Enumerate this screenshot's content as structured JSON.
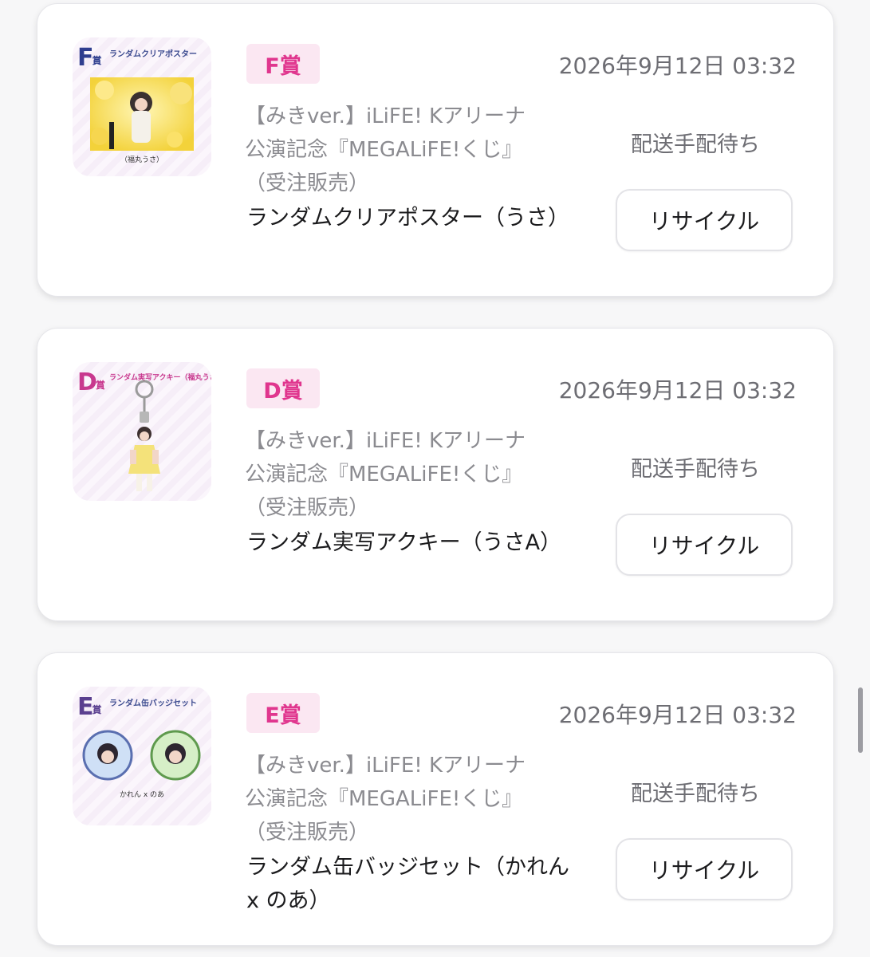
{
  "items": [
    {
      "badge": "F賞",
      "date": "2026年9月12日 03:32",
      "lottery_lines": [
        "【みきver.】iLiFE! Kアリーナ",
        "公演記念『MEGALiFE!くじ』",
        "（受注販売）"
      ],
      "prize_name": "ランダムクリアポスター（うさ）",
      "status": "配送手配待ち",
      "action_label": "リサイクル",
      "thumb_letter": "F",
      "thumb_caption": "ランダムクリアポスター",
      "thumb_footer": "（福丸うさ）",
      "thumb_icon": "poster-image-icon"
    },
    {
      "badge": "D賞",
      "date": "2026年9月12日 03:32",
      "lottery_lines": [
        "【みきver.】iLiFE! Kアリーナ",
        "公演記念『MEGALiFE!くじ』",
        "（受注販売）"
      ],
      "prize_name": "ランダム実写アクキー（うさA）",
      "status": "配送手配待ち",
      "action_label": "リサイクル",
      "thumb_letter": "D",
      "thumb_caption": "ランダム実写アクキー（福丸うさ A）",
      "thumb_footer": "",
      "thumb_icon": "acrylic-keychain-icon"
    },
    {
      "badge": "E賞",
      "date": "2026年9月12日 03:32",
      "lottery_lines": [
        "【みきver.】iLiFE! Kアリーナ",
        "公演記念『MEGALiFE!くじ』",
        "（受注販売）"
      ],
      "prize_name": "ランダム缶バッジセット（かれん x のあ）",
      "status": "配送手配待ち",
      "action_label": "リサイクル",
      "thumb_letter": "E",
      "thumb_caption": "ランダム缶バッジセット",
      "thumb_footer": "かれん x のあ",
      "thumb_icon": "can-badge-icon"
    }
  ],
  "colors": {
    "badge_bg": "#fbe7f2",
    "badge_text": "#e0368e",
    "status_text": "#6d6d73",
    "lottery_text": "#8b8b90"
  }
}
